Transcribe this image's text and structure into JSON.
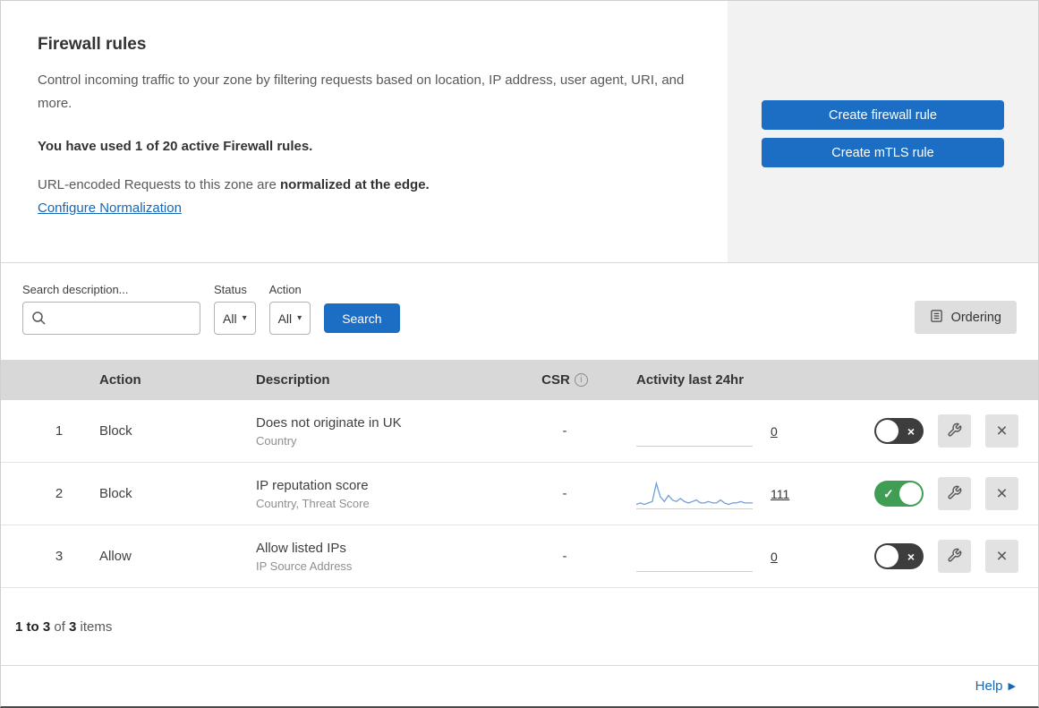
{
  "colors": {
    "accent_blue": "#1b6ec3",
    "link_blue": "#1667b5",
    "toggle_green": "#3f9e54",
    "toggle_off": "#3d3d3d",
    "header_gray": "#d8d8d8",
    "panel_gray": "#f2f2f2",
    "sparkline_blue": "#6f9fd8"
  },
  "intro": {
    "title": "Firewall rules",
    "description": "Control incoming traffic to your zone by filtering requests based on location, IP address, user agent, URI, and more.",
    "usage": "You have used 1 of 20 active Firewall rules.",
    "normalization_text": "URL-encoded Requests to this zone are ",
    "normalization_bold": "normalized at the edge.",
    "normalization_link": "Configure Normalization"
  },
  "actions_panel": {
    "create_firewall_rule": "Create firewall rule",
    "create_mtls_rule": "Create mTLS rule"
  },
  "filters": {
    "search_label": "Search description...",
    "status_label": "Status",
    "status_value": "All",
    "action_label": "Action",
    "action_value": "All",
    "search_button": "Search",
    "ordering_button": "Ordering"
  },
  "table": {
    "headers": {
      "action": "Action",
      "description": "Description",
      "csr": "CSR",
      "activity": "Activity last 24hr"
    },
    "rows": [
      {
        "num": "1",
        "action": "Block",
        "description": "Does not originate in UK",
        "criteria": "Country",
        "csr": "-",
        "count": "0",
        "enabled": false,
        "sparkline": []
      },
      {
        "num": "2",
        "action": "Block",
        "description": "IP reputation score",
        "criteria": "Country, Threat Score",
        "csr": "-",
        "count": "111",
        "enabled": true,
        "sparkline": [
          2,
          3,
          2,
          3,
          4,
          16,
          7,
          4,
          8,
          5,
          4,
          6,
          4,
          3,
          4,
          5,
          3,
          3,
          4,
          3,
          3,
          5,
          3,
          2,
          3,
          3,
          4,
          3,
          3,
          3
        ]
      },
      {
        "num": "3",
        "action": "Allow",
        "description": "Allow listed IPs",
        "criteria": "IP Source Address",
        "csr": "-",
        "count": "0",
        "enabled": false,
        "sparkline": []
      }
    ]
  },
  "footer": {
    "range": "1 to 3",
    "of_text": " of ",
    "total": "3",
    "items_text": " items"
  },
  "help": {
    "label": "Help"
  }
}
